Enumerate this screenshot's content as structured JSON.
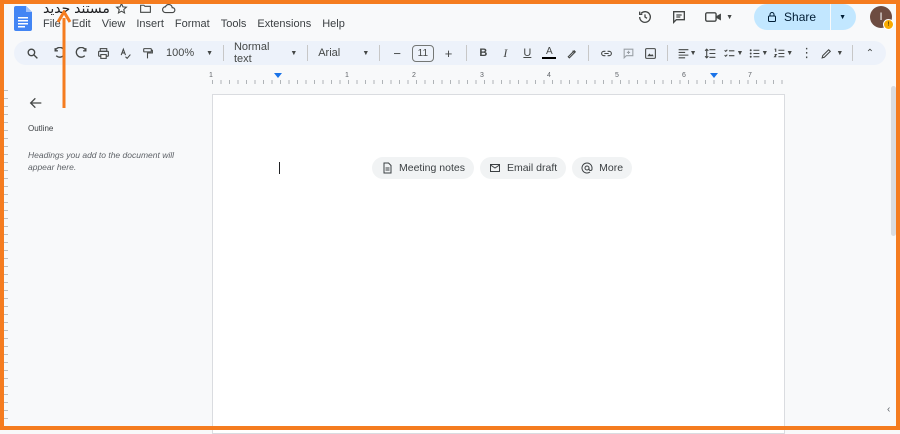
{
  "document": {
    "title": "مستند جديد"
  },
  "menubar": [
    "File",
    "Edit",
    "View",
    "Insert",
    "Format",
    "Tools",
    "Extensions",
    "Help"
  ],
  "header": {
    "share_label": "Share",
    "avatar_initial": "I",
    "avatar_badge": "!",
    "icons": [
      "history-icon",
      "comment-icon",
      "meet-icon",
      "lock-icon"
    ]
  },
  "toolbar": {
    "zoom": "100%",
    "style": "Normal text",
    "font": "Arial",
    "font_size": "11",
    "minus": "−",
    "plus": "+"
  },
  "ruler": {
    "numbers": [
      "1",
      "1",
      "2",
      "3",
      "4",
      "5",
      "6",
      "7"
    ]
  },
  "outline": {
    "label": "Outline",
    "hint": "Headings you add to the document will appear here."
  },
  "chips": [
    {
      "label": "Meeting notes",
      "icon": "document-icon"
    },
    {
      "label": "Email draft",
      "icon": "email-icon"
    },
    {
      "label": "More",
      "icon": "at-icon"
    }
  ],
  "colors": {
    "accent": "#1a73e8",
    "share_bg": "#c2e7ff",
    "annotation": "#f57c1f",
    "toolbar_bg": "#edf2fa"
  }
}
